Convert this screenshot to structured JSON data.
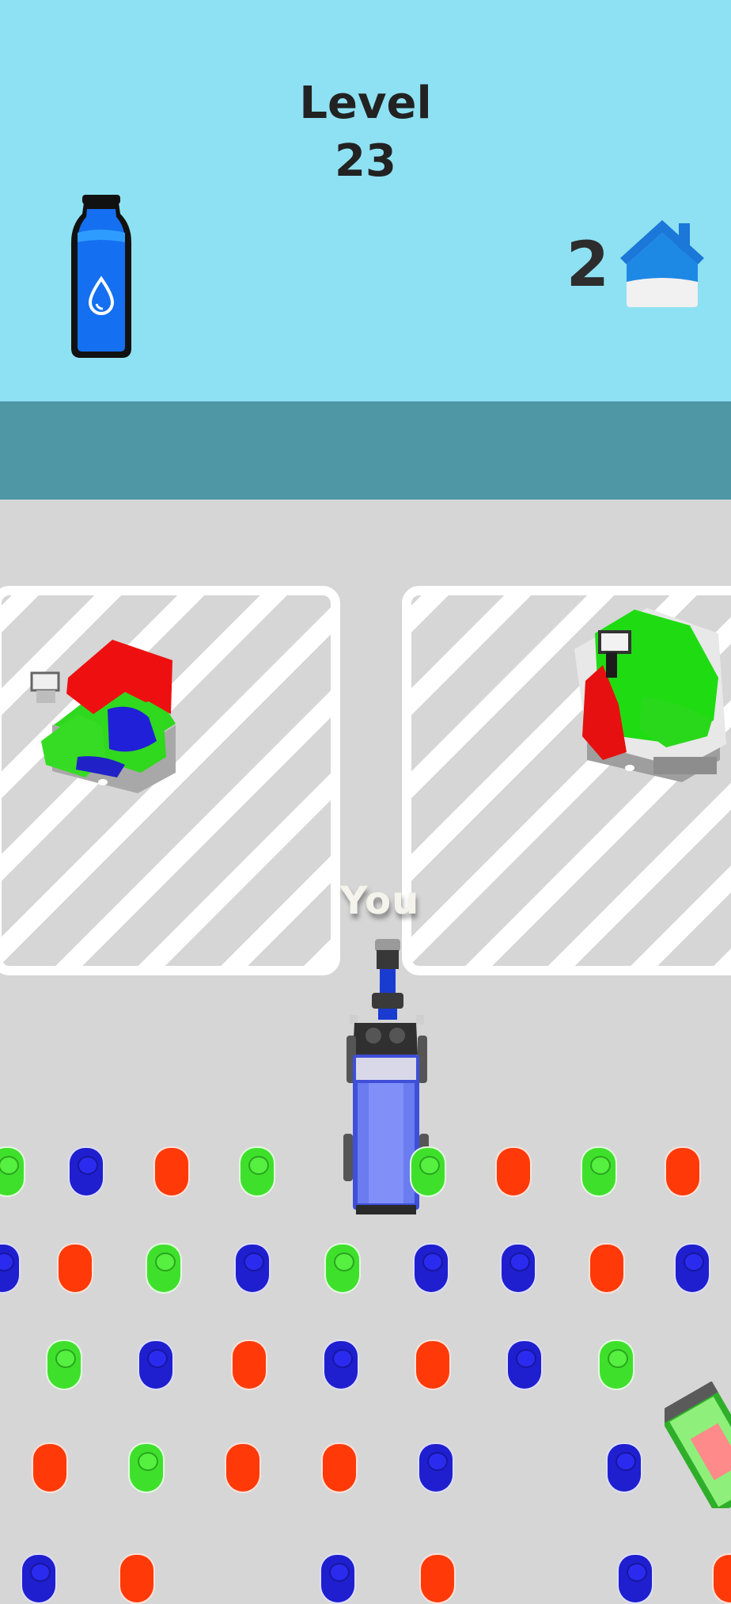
{
  "hud": {
    "level_label": "Level",
    "level_number": "23",
    "houses_remaining": "2",
    "bottle_icon": "water-bottle-icon",
    "house_icon": "house-icon"
  },
  "player": {
    "label": "You"
  },
  "colors": {
    "sky": "#8ee1f2",
    "band": "#4f97a5",
    "ground": "#d6d6d6",
    "paint_red": "#ff3a08",
    "paint_blue": "#1f1fcf",
    "paint_green": "#3fe02c"
  },
  "paint_cups": [
    [
      "green",
      "blue",
      "red",
      "green",
      "green",
      "red",
      "green",
      "red"
    ],
    [
      "blue",
      "red",
      "green",
      "blue",
      "green",
      "blue",
      "blue",
      "red",
      "blue"
    ],
    [
      "green",
      "blue",
      "red",
      "blue",
      "red",
      "blue",
      "green"
    ],
    [
      "red",
      "green",
      "red",
      "red",
      "blue",
      "blue"
    ],
    [
      "blue",
      "red",
      "blue",
      "red",
      "blue",
      "red"
    ]
  ]
}
